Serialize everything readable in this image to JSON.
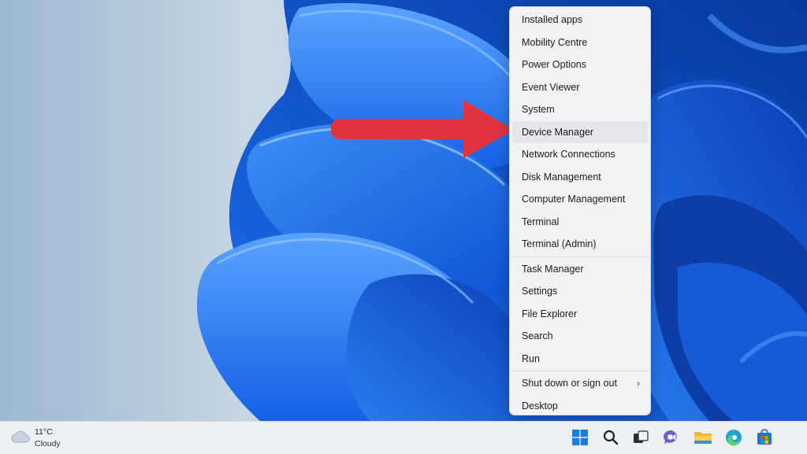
{
  "menu": {
    "items": [
      {
        "label": "Installed apps"
      },
      {
        "label": "Mobility Centre"
      },
      {
        "label": "Power Options"
      },
      {
        "label": "Event Viewer"
      },
      {
        "label": "System"
      },
      {
        "label": "Device Manager",
        "highlighted": true
      },
      {
        "label": "Network Connections"
      },
      {
        "label": "Disk Management"
      },
      {
        "label": "Computer Management"
      },
      {
        "label": "Terminal"
      },
      {
        "label": "Terminal (Admin)"
      },
      {
        "label": "Task Manager"
      },
      {
        "label": "Settings"
      },
      {
        "label": "File Explorer"
      },
      {
        "label": "Search"
      },
      {
        "label": "Run"
      },
      {
        "label": "Shut down or sign out",
        "submenu_glyph": "›"
      },
      {
        "label": "Desktop"
      }
    ]
  },
  "weather": {
    "temperature": "11°C",
    "condition": "Cloudy",
    "icon": "cloud-icon"
  },
  "taskbar": {
    "icons": [
      "windows-start-icon",
      "search-icon",
      "task-view-icon",
      "teams-chat-icon",
      "file-explorer-icon",
      "edge-browser-icon",
      "microsoft-store-icon"
    ]
  },
  "colors": {
    "accent_blue": "#1565e0",
    "arrow_red": "#e2343f",
    "menu_bg": "#f2f3f5",
    "highlight_bg": "#e5e7ea"
  }
}
